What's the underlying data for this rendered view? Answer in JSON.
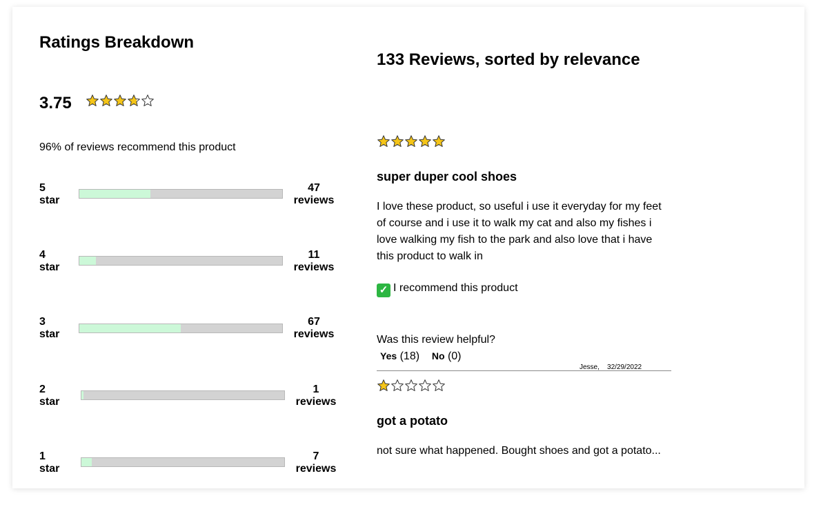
{
  "breakdown": {
    "heading": "Ratings Breakdown",
    "average": "3.75",
    "average_stars": 3.75,
    "recommend_text": "96% of reviews recommend this product",
    "rows": [
      {
        "label": "5 star",
        "count": "47",
        "unit": "reviews",
        "fill_fraction": 0.35
      },
      {
        "label": "4 star",
        "count": "11",
        "unit": "reviews",
        "fill_fraction": 0.08
      },
      {
        "label": "3 star",
        "count": "67",
        "unit": "reviews",
        "fill_fraction": 0.5
      },
      {
        "label": "2 star",
        "count": "1",
        "unit": "reviews",
        "fill_fraction": 0.01
      },
      {
        "label": "1 star",
        "count": "7",
        "unit": "reviews",
        "fill_fraction": 0.05
      }
    ]
  },
  "reviews_header": {
    "title": "133 Reviews, sorted by relevance"
  },
  "reviews": [
    {
      "rating": 5,
      "title": "super duper cool shoes",
      "body": "I love these product, so useful i use it everyday for my feet of course and i use it to walk my cat and also my fishes i love walking my fish to the park and also love that i have this product to walk in",
      "recommend": "I recommend this product",
      "helpful_prompt": "Was this review helpful?",
      "yes_label": "Yes",
      "yes_count": "(18)",
      "no_label": "No",
      "no_count": "(0)",
      "author": "Jesse,",
      "date": "32/29/2022"
    },
    {
      "rating": 1,
      "title": "got a potato",
      "body": "not sure what happened. Bought shoes and got a potato..."
    }
  ],
  "colors": {
    "star_fill": "#f5c518",
    "bar_fill": "#ccf8d8",
    "bar_track": "#d3d3d3",
    "check": "#2db642"
  }
}
